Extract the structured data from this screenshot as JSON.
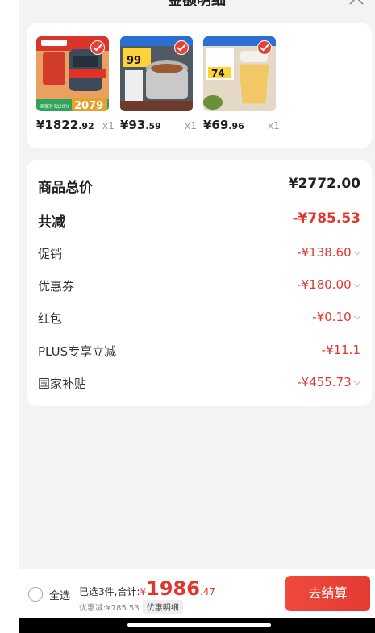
{
  "header": {
    "title": "金额明细"
  },
  "products": [
    {
      "price_int": "¥1822",
      "price_dec": ".92",
      "qty": "x1",
      "image": "air-fryer",
      "tag": "2079",
      "banner": "国家补贴20%"
    },
    {
      "price_int": "¥93",
      "price_dec": ".59",
      "qty": "x1",
      "image": "rice-cooker",
      "tag": "99"
    },
    {
      "price_int": "¥69",
      "price_dec": ".96",
      "qty": "x1",
      "image": "food-processor",
      "tag": "74"
    }
  ],
  "summary": {
    "total": {
      "label": "商品总价",
      "value": "¥2772.00"
    },
    "reduce": {
      "label": "共减",
      "value": "-¥785.53"
    },
    "items": [
      {
        "label": "促销",
        "value": "-¥138.60",
        "chevron": true
      },
      {
        "label": "优惠券",
        "value": "-¥180.00",
        "chevron": true
      },
      {
        "label": "红包",
        "value": "-¥0.10",
        "chevron": true
      },
      {
        "label": "PLUS专享立减",
        "value": "-¥11.1",
        "chevron": false
      },
      {
        "label": "国家补贴",
        "value": "-¥455.73",
        "chevron": true
      }
    ]
  },
  "bottom": {
    "select_all": "全选",
    "selected_text": "已选3件,合计:",
    "currency": "¥",
    "amount_int": "1986",
    "amount_dec": ".47",
    "discount_text": "优惠减:¥785.53",
    "detail_label": "优惠明细",
    "checkout_label": "去结算"
  },
  "colors": {
    "accent": "#e2362c",
    "checkout": "#e8413a"
  }
}
